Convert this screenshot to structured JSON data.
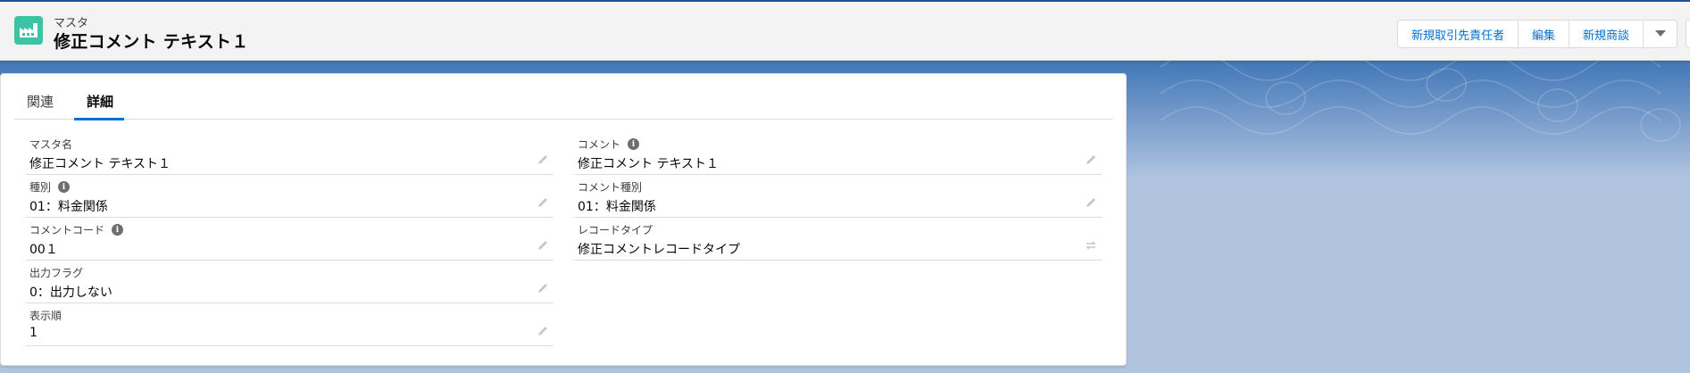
{
  "header": {
    "object_type": "マスタ",
    "record_title": "修正コメント テキスト１",
    "buttons": [
      "新規取引先責任者",
      "編集",
      "新規商談"
    ]
  },
  "tabs": [
    "関連",
    "詳細"
  ],
  "fields_left": [
    {
      "label": "マスタ名",
      "value": "修正コメント テキスト１",
      "info": false
    },
    {
      "label": "種別",
      "value": "01：料金関係",
      "info": true
    },
    {
      "label": "コメントコード",
      "value": "00１",
      "info": true
    },
    {
      "label": "出力フラグ",
      "value": "0：出力しない",
      "info": false
    },
    {
      "label": "表示順",
      "value": "1",
      "info": false
    }
  ],
  "fields_right": [
    {
      "label": "コメント",
      "value": "修正コメント テキスト１",
      "info": true
    },
    {
      "label": "コメント種別",
      "value": "01：料金関係",
      "info": false
    },
    {
      "label": "レコードタイプ",
      "value": "修正コメントレコードタイプ",
      "info": false
    }
  ],
  "colors": {
    "brand_blue": "#0070d2",
    "object_icon": "#3bc4a3",
    "header_bg": "#f3f3f3"
  },
  "icons": {
    "object": "factory-icon",
    "edit": "pencil-icon",
    "change_type": "swap-icon",
    "menu": "chevron-down-icon",
    "info": "info-icon"
  }
}
